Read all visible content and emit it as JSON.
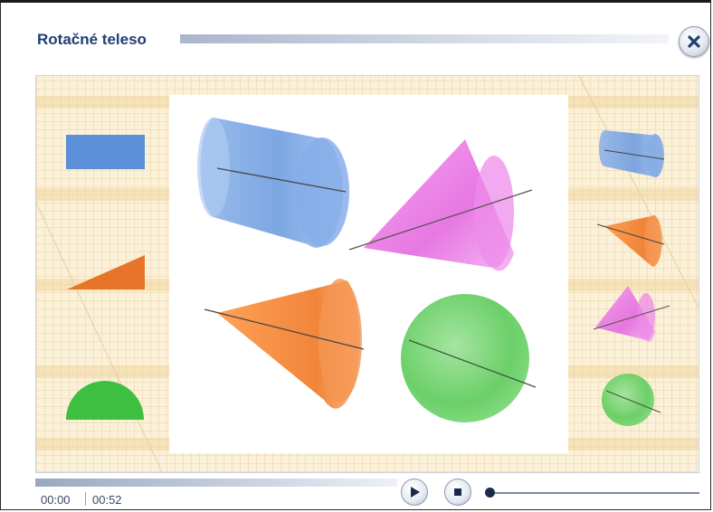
{
  "window": {
    "title": "Rotačné teleso",
    "close_icon": "close-x-icon"
  },
  "player": {
    "current_time": "00:00",
    "total_time": "00:52",
    "play_icon": "play-icon",
    "stop_icon": "stop-icon",
    "progress_fraction": 0.0
  },
  "colors": {
    "title": "#1f3f73",
    "rectangle_cylinder": "#5b8fd8",
    "triangle_cone": "#e8742a",
    "half_disc_sphere": "#3fbf3f",
    "magenta_cone": "#e060d8"
  },
  "stage": {
    "left_shapes": [
      "rectangle",
      "right-triangle",
      "half-disc"
    ],
    "center_solids": [
      "cylinder",
      "magenta-cone",
      "orange-cone",
      "sphere"
    ],
    "right_thumbnails": [
      "cylinder",
      "orange-cone",
      "magenta-cone",
      "sphere"
    ]
  }
}
